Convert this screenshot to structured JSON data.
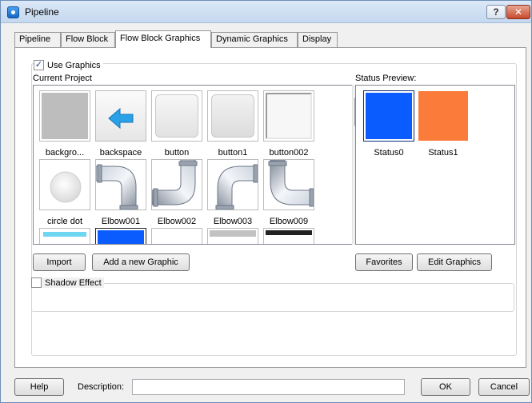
{
  "window": {
    "title": "Pipeline"
  },
  "title_buttons": {
    "help": "?",
    "close": "✕"
  },
  "tabs": [
    {
      "label": "Pipeline"
    },
    {
      "label": "Flow Block"
    },
    {
      "label": "Flow Block Graphics"
    },
    {
      "label": "Dynamic Graphics"
    },
    {
      "label": "Display"
    }
  ],
  "use_graphics": {
    "label": "Use Graphics",
    "checked": true
  },
  "current_project_label": "Current Project",
  "status_preview_label": "Status Preview:",
  "graphics": [
    {
      "name": "backgro...",
      "icon": "gray-square-icon"
    },
    {
      "name": "backspace",
      "icon": "left-arrow-icon"
    },
    {
      "name": "button",
      "icon": "button-shape-icon"
    },
    {
      "name": "button1",
      "icon": "button-shape-icon"
    },
    {
      "name": "button002",
      "icon": "button-shape-icon"
    },
    {
      "name": "circle dot",
      "icon": "circle-dot-icon"
    },
    {
      "name": "Elbow001",
      "icon": "pipe-elbow-icon"
    },
    {
      "name": "Elbow002",
      "icon": "pipe-elbow-icon"
    },
    {
      "name": "Elbow003",
      "icon": "pipe-elbow-icon"
    },
    {
      "name": "Elbow009",
      "icon": "pipe-elbow-icon"
    }
  ],
  "statuses": [
    {
      "name": "Status0",
      "color": "#0a5cff"
    },
    {
      "name": "Status1",
      "color": "#fa7b3a"
    }
  ],
  "buttons": {
    "import": "Import",
    "add_graphic": "Add a new Graphic",
    "favorites": "Favorites",
    "edit_graphics": "Edit Graphics",
    "help": "Help",
    "ok": "OK",
    "cancel": "Cancel"
  },
  "shadow_effect": {
    "label": "Shadow Effect",
    "checked": false
  },
  "description": {
    "label": "Description:",
    "value": ""
  },
  "colors": {
    "accent_blue": "#0a5cff",
    "orange": "#fa7b3a",
    "cyan": "#6fd6f2"
  }
}
